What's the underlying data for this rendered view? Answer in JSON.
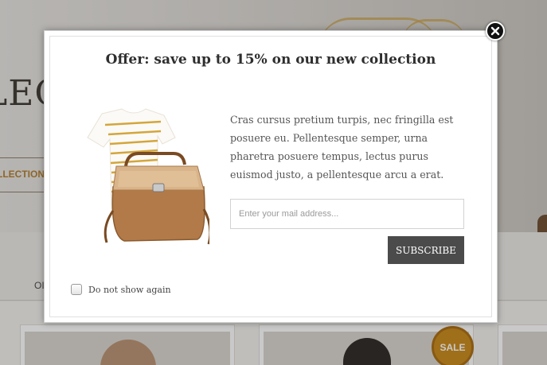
{
  "background": {
    "hero_text": "LECTI",
    "hero_link": "LLECTION",
    "nav_stub": "OI",
    "sale_badge": "SALE"
  },
  "popup": {
    "title": "Offer: save up to 15% on our new collection",
    "description": "Cras cursus pretium turpis, nec fringilla est posuere eu. Pellentesque semper, urna pharetra posuere tempus, lectus purus euismod justo, a pellentesque arcu a erat.",
    "email_placeholder": "Enter your mail address...",
    "email_value": "",
    "subscribe_label": "SUBSCRIBE",
    "dont_show_label": "Do not show again",
    "dont_show_checked": false,
    "close_icon": "close-icon",
    "product_image": "tshirt-and-bag-image"
  },
  "colors": {
    "accent_gold": "#c98716",
    "button_dark": "#4b4b4b",
    "title_text": "#2e2e2e"
  }
}
